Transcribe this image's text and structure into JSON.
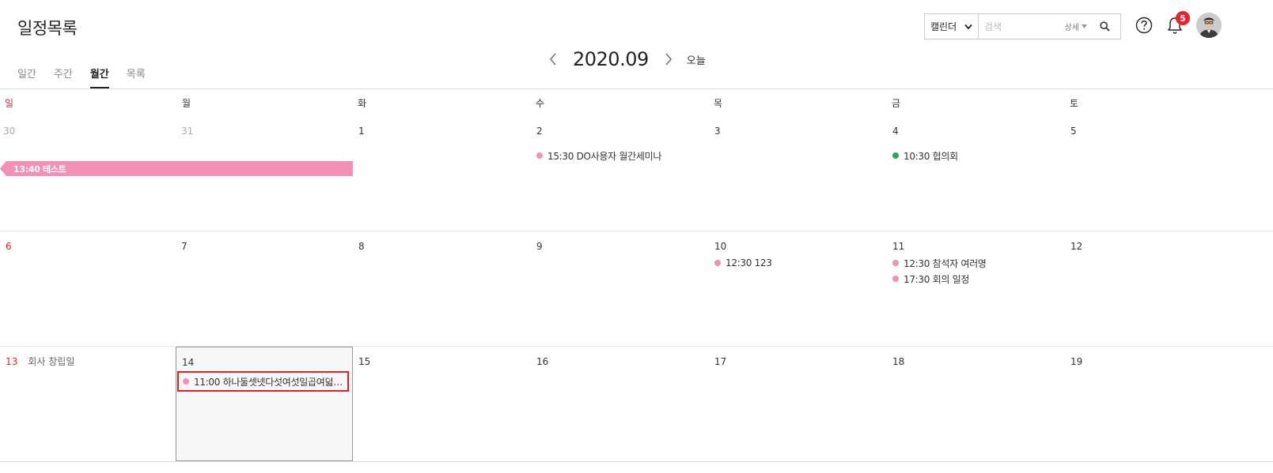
{
  "header": {
    "title": "일정목록",
    "tabs": [
      {
        "label": "일간",
        "active": false
      },
      {
        "label": "주간",
        "active": false
      },
      {
        "label": "월간",
        "active": true
      },
      {
        "label": "목록",
        "active": false
      }
    ]
  },
  "nav": {
    "current": "2020.09",
    "today_label": "오늘",
    "prev_icon": "chevron-left-icon",
    "next_icon": "chevron-right-icon"
  },
  "search": {
    "scope": "캘린더",
    "placeholder": "검색",
    "detail_label": "상세",
    "icon": "search-icon"
  },
  "toolbar": {
    "help_icon": "help-circle-icon",
    "bell_icon": "bell-icon",
    "notification_count": "5"
  },
  "colors": {
    "accent_pink": "#f291b3",
    "green": "#2fa25b",
    "sunday_red": "#e8212d",
    "badge_red": "#e8212d",
    "highlight_border": "#d8212b"
  },
  "calendar": {
    "weekdays": [
      "일",
      "월",
      "화",
      "수",
      "목",
      "금",
      "토"
    ],
    "weeks": [
      {
        "days": [
          {
            "num": "30",
            "other_month": true,
            "events": []
          },
          {
            "num": "31",
            "other_month": true,
            "events": []
          },
          {
            "num": "1",
            "events": []
          },
          {
            "num": "2",
            "events": [
              {
                "text": "15:30 DO사용자 월간세미나",
                "color": "pink"
              }
            ]
          },
          {
            "num": "3",
            "events": []
          },
          {
            "num": "4",
            "events": [
              {
                "text": "10:30 협의회",
                "color": "green"
              }
            ]
          },
          {
            "num": "5",
            "events": []
          }
        ],
        "span_event": {
          "text": "13:40 테스트"
        }
      },
      {
        "days": [
          {
            "num": "6",
            "events": []
          },
          {
            "num": "7",
            "events": []
          },
          {
            "num": "8",
            "events": []
          },
          {
            "num": "9",
            "events": []
          },
          {
            "num": "10",
            "events": [
              {
                "text": "12:30 123",
                "color": "pink"
              }
            ]
          },
          {
            "num": "11",
            "events": [
              {
                "text": "12:30 참석자 여러명",
                "color": "pink"
              },
              {
                "text": "17:30 회의 일정",
                "color": "pink"
              }
            ]
          },
          {
            "num": "12",
            "events": []
          }
        ]
      },
      {
        "days": [
          {
            "num": "13",
            "holiday": "회사 창립일",
            "events": []
          },
          {
            "num": "14",
            "selected": true,
            "events": [
              {
                "text": "11:00 하나둘셋넷다섯여섯일곱여덟아…",
                "color": "pink",
                "highlight": true
              }
            ]
          },
          {
            "num": "15",
            "events": []
          },
          {
            "num": "16",
            "events": []
          },
          {
            "num": "17",
            "events": []
          },
          {
            "num": "18",
            "events": []
          },
          {
            "num": "19",
            "events": []
          }
        ]
      }
    ]
  }
}
